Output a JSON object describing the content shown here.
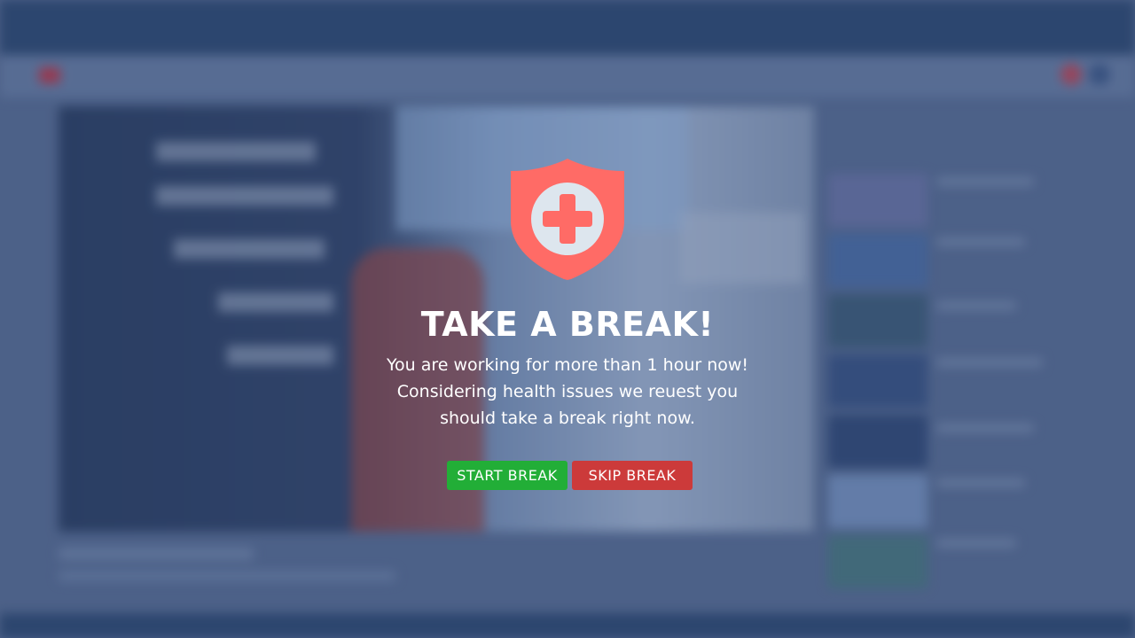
{
  "modal": {
    "title": "TAKE A BREAK!",
    "message": "You are working for more than 1 hour now! Considering health issues we reuest you should take a break right now.",
    "icon": "medical-shield-icon",
    "start_button_label": "START BREAK",
    "skip_button_label": "SKIP BREAK"
  },
  "colors": {
    "shield": "#ff6b66",
    "shield_inner": "#dde6ee",
    "cross": "#ff6b66",
    "start_button": "#22ae37",
    "skip_button": "#cc3a3a",
    "overlay": "#263c64"
  }
}
